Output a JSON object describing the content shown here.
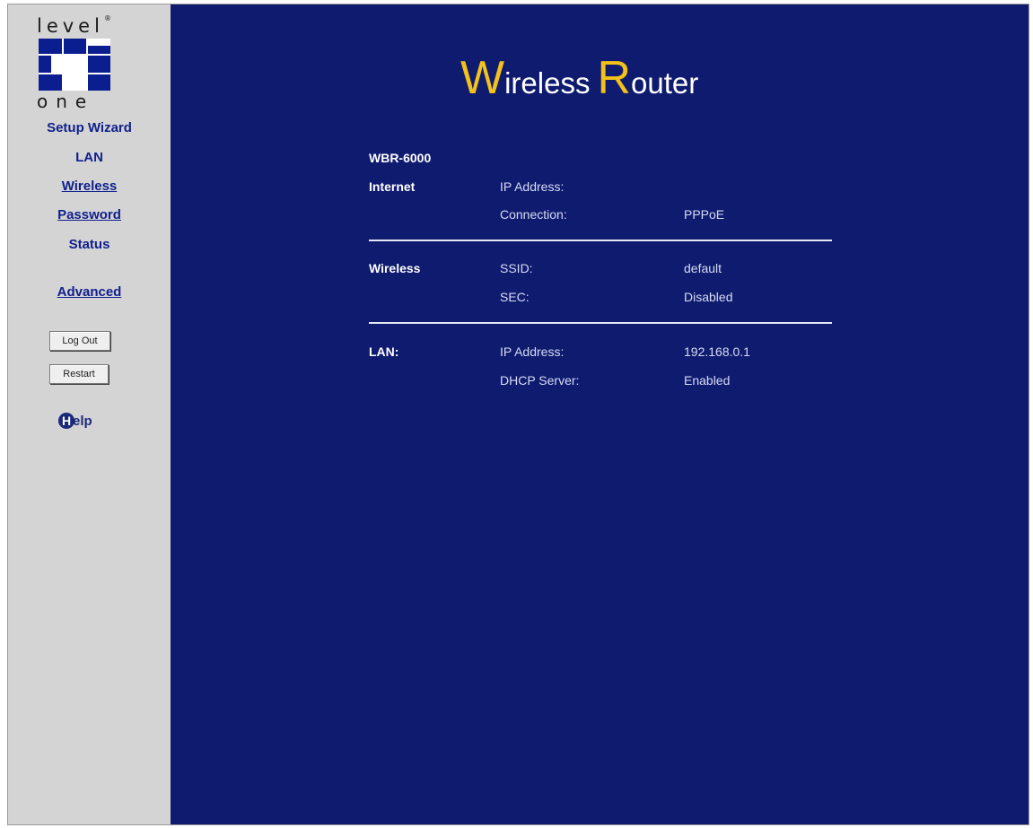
{
  "logo": {
    "word_top": "level",
    "mark": "®",
    "word_bottom": "one"
  },
  "nav": {
    "setup_wizard": "Setup Wizard",
    "lan": "LAN",
    "wireless": "Wireless",
    "password": "Password",
    "status": "Status",
    "advanced": "Advanced"
  },
  "buttons": {
    "logout": "Log Out",
    "restart": "Restart"
  },
  "help": {
    "icon_letter": "H",
    "label": "elp"
  },
  "title": {
    "w_cap": "W",
    "w_rest": "ireless",
    "r_cap": "R",
    "r_rest": "outer"
  },
  "model": "WBR-6000",
  "sections": {
    "internet": {
      "heading": "Internet",
      "ip_label": "IP Address:",
      "ip_value": "",
      "conn_label": "Connection:",
      "conn_value": "PPPoE"
    },
    "wireless": {
      "heading": "Wireless",
      "ssid_label": "SSID:",
      "ssid_value": "default",
      "sec_label": "SEC:",
      "sec_value": "Disabled"
    },
    "lan": {
      "heading": "LAN:",
      "ip_label": "IP Address:",
      "ip_value": "192.168.0.1",
      "dhcp_label": "DHCP Server:",
      "dhcp_value": "Enabled"
    }
  },
  "colors": {
    "sidebar_bg": "#d4d4d4",
    "main_bg": "#0f1b6f",
    "nav_link": "#0f1f8c",
    "title_accent": "#f2c21a"
  }
}
